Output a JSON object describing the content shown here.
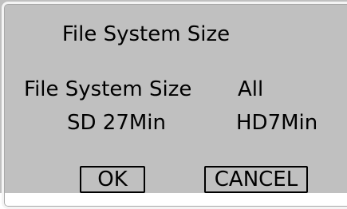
{
  "dialog": {
    "title": "File System Size",
    "file_system_label": "File System Size",
    "file_system_value": "All",
    "sd_text": "SD 27Min",
    "hd_text": "HD7Min"
  },
  "buttons": {
    "ok_label": "OK",
    "cancel_label": "CANCEL"
  },
  "colors": {
    "background": "#c0c0c0",
    "frame": "#f4f4f4",
    "text": "#000000"
  }
}
